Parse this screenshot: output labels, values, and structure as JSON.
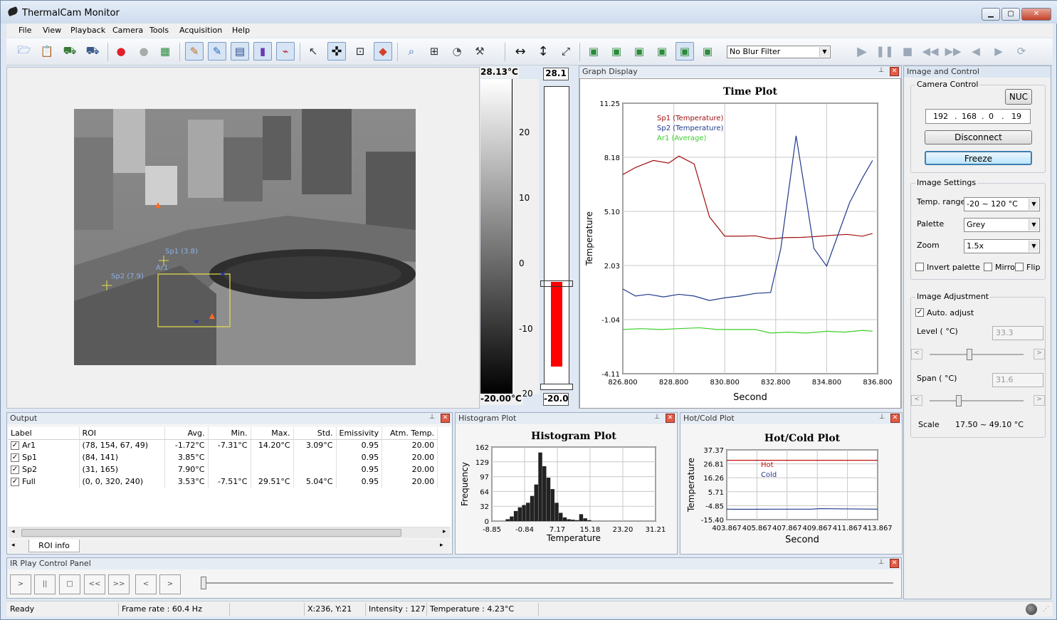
{
  "app": {
    "title": "ThermalCam Monitor"
  },
  "menu": [
    "File",
    "View",
    "Playback",
    "Camera",
    "Tools",
    "Acquisition",
    "Help"
  ],
  "toolbar": {
    "blur_filter": "No Blur Filter"
  },
  "thermal_view": {
    "labels": [
      {
        "text": "Sp1 (3.8)",
        "kind": "spot"
      },
      {
        "text": "Ar1",
        "kind": "area"
      },
      {
        "text": "Sp2 (7.9)",
        "kind": "spot"
      }
    ]
  },
  "colorbar": {
    "max_label": "28.13°C",
    "min_label": "-20.00°C",
    "ticks": [
      "20",
      "10",
      "0",
      "-10",
      "-20"
    ],
    "top_value": "28.1",
    "bottom_value": "-20.0",
    "fill_level": 0.58
  },
  "graph_display": {
    "panel_title": "Graph Display",
    "chart_data": {
      "type": "line",
      "title": "Time Plot",
      "xlabel": "Second",
      "ylabel": "Temperature",
      "xlim": [
        826.8,
        836.8
      ],
      "ylim": [
        -4.11,
        11.25
      ],
      "xticks": [
        "826.800",
        "828.800",
        "830.800",
        "832.800",
        "834.800",
        "836.800"
      ],
      "yticks": [
        "11.25",
        "8.18",
        "5.10",
        "2.03",
        "-1.04",
        "-4.11"
      ],
      "legend_position": "top-left",
      "series": [
        {
          "name": "Sp1 (Temperature)",
          "color": "#a01010",
          "x": [
            826.8,
            827.3,
            828.0,
            828.6,
            829.0,
            829.6,
            830.2,
            830.8,
            831.4,
            832.0,
            832.6,
            833.2,
            833.8,
            834.4,
            835.0,
            835.6,
            836.2,
            836.6
          ],
          "y": [
            7.2,
            7.6,
            8.0,
            7.85,
            8.25,
            7.8,
            4.8,
            3.7,
            3.7,
            3.72,
            3.55,
            3.62,
            3.63,
            3.68,
            3.75,
            3.8,
            3.7,
            3.85
          ]
        },
        {
          "name": "Sp2 (Temperature)",
          "color": "#203a8c",
          "x": [
            826.8,
            827.3,
            827.8,
            828.4,
            829.0,
            829.6,
            830.2,
            830.8,
            831.4,
            832.0,
            832.6,
            833.0,
            833.6,
            834.0,
            834.3,
            834.8,
            835.2,
            835.7,
            836.2,
            836.6
          ],
          "y": [
            0.7,
            0.3,
            0.4,
            0.25,
            0.4,
            0.3,
            0.05,
            0.2,
            0.3,
            0.45,
            0.5,
            3.0,
            9.4,
            5.8,
            3.0,
            2.0,
            3.6,
            5.6,
            7.0,
            8.0
          ]
        },
        {
          "name": "Ar1 (Average)",
          "color": "#3ccf2c",
          "x": [
            826.8,
            827.5,
            828.3,
            829.0,
            829.8,
            830.5,
            831.2,
            832.0,
            832.6,
            833.3,
            834.0,
            834.8,
            835.5,
            836.2,
            836.6
          ],
          "y": [
            -1.6,
            -1.55,
            -1.6,
            -1.55,
            -1.5,
            -1.6,
            -1.6,
            -1.6,
            -1.8,
            -1.75,
            -1.8,
            -1.7,
            -1.75,
            -1.65,
            -1.7
          ]
        }
      ]
    }
  },
  "image_control": {
    "panel_title": "Image and Control",
    "camera_control": {
      "label": "Camera Control",
      "nuc": "NUC",
      "ip": [
        "192",
        "168",
        "0",
        "19"
      ],
      "disconnect": "Disconnect",
      "freeze": "Freeze"
    },
    "image_settings": {
      "label": "Image Settings",
      "temp_range_label": "Temp. range",
      "temp_range_value": "-20 ~ 120 °C",
      "palette_label": "Palette",
      "palette_value": "Grey",
      "zoom_label": "Zoom",
      "zoom_value": "1.5x",
      "invert_label": "Invert palette",
      "mirror_label": "Mirror",
      "flip_label": "Flip"
    },
    "image_adjustment": {
      "label": "Image Adjustment",
      "auto_label": "Auto. adjust",
      "level_label": "Level ( °C)",
      "level_value": "33.3",
      "span_label": "Span ( °C)",
      "span_value": "31.6",
      "scale_label": "Scale",
      "scale_value": "17.50 ~ 49.10 °C",
      "level_slider": 0.42,
      "span_slider": 0.3
    }
  },
  "output": {
    "panel_title": "Output",
    "columns": [
      "Label",
      "ROI",
      "Avg.",
      "Min.",
      "Max.",
      "Std.",
      "Emissivity",
      "Atm. Temp."
    ],
    "rows": [
      [
        "Ar1",
        "(78, 154, 67, 49)",
        "-1.72°C",
        "-7.31°C",
        "14.20°C",
        "3.09°C",
        "0.95",
        "20.00"
      ],
      [
        "Sp1",
        "(84, 141)",
        "3.85°C",
        "",
        "",
        "",
        "0.95",
        "20.00"
      ],
      [
        "Sp2",
        "(31, 165)",
        "7.90°C",
        "",
        "",
        "",
        "0.95",
        "20.00"
      ],
      [
        "Full",
        "(0, 0, 320, 240)",
        "3.53°C",
        "-7.51°C",
        "29.51°C",
        "5.04°C",
        "0.95",
        "20.00"
      ]
    ],
    "tab": "ROI info"
  },
  "histogram": {
    "panel_title": "Histogram Plot",
    "chart_data": {
      "type": "bar",
      "title": "Histogram Plot",
      "xlabel": "Temperature",
      "ylabel": "Frequency",
      "xlim": [
        -8.85,
        31.21
      ],
      "ylim": [
        0,
        162
      ],
      "xticks": [
        "-8.85",
        "-0.84",
        "7.17",
        "15.18",
        "23.20",
        "31.21"
      ],
      "yticks": [
        "162",
        "129",
        "97",
        "64",
        "32",
        "0"
      ],
      "x": [
        -5.0,
        -4.0,
        -3.0,
        -2.0,
        -1.0,
        0.0,
        1.0,
        2.0,
        3.0,
        4.0,
        5.0,
        6.0,
        7.0,
        8.0,
        9.0,
        10.0,
        11.0,
        12.0,
        13.0,
        14.0,
        15.0
      ],
      "values": [
        4,
        10,
        22,
        30,
        35,
        40,
        55,
        80,
        150,
        120,
        95,
        70,
        40,
        18,
        8,
        4,
        3,
        2,
        15,
        6,
        2
      ]
    }
  },
  "hotcold": {
    "panel_title": "Hot/Cold Plot",
    "chart_data": {
      "type": "line",
      "title": "Hot/Cold Plot",
      "xlabel": "Second",
      "ylabel": "Temperature",
      "xlim": [
        403.867,
        413.867
      ],
      "ylim": [
        -15.4,
        37.37
      ],
      "xticks": [
        "403.867",
        "405.867",
        "407.867",
        "409.867",
        "411.867",
        "413.867"
      ],
      "yticks": [
        "37.37",
        "26.81",
        "16.26",
        "5.71",
        "-4.85",
        "-15.40"
      ],
      "legend_position": "top-left",
      "series": [
        {
          "name": "Hot",
          "color": "#c01010",
          "x": [
            403.867,
            413.867
          ],
          "y": [
            29.5,
            29.5
          ]
        },
        {
          "name": "Cold",
          "color": "#203a8c",
          "x": [
            403.867,
            405.0,
            407.0,
            409.5,
            410.0,
            413.867
          ],
          "y": [
            -7.5,
            -7.6,
            -7.5,
            -7.5,
            -7.1,
            -7.5
          ]
        }
      ]
    }
  },
  "play_panel": {
    "panel_title": "IR Play Control Panel",
    "buttons": [
      ">",
      "||",
      "□",
      "<<",
      ">>",
      "<",
      ">"
    ]
  },
  "status": {
    "ready": "Ready",
    "frame_rate": "Frame rate : 60.4 Hz",
    "coords": "X:236, Y:21",
    "intensity": "Intensity : 127",
    "temperature": "Temperature : 4.23°C"
  }
}
